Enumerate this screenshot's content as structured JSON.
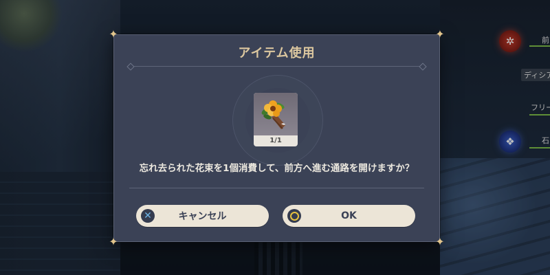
{
  "dialog": {
    "title": "アイテム使用",
    "item": {
      "icon": "flower-bouquet-icon",
      "count": "1/1"
    },
    "message": "忘れ去られた花束を1個消費して、前方へ進む通路を開けますか？",
    "buttons": {
      "cancel": {
        "label": "キャンセル",
        "icon": "cross-button-icon"
      },
      "ok": {
        "label": "OK",
        "icon": "circle-button-icon"
      }
    }
  },
  "hud": {
    "party_names": [
      "ディシア",
      "フリー"
    ],
    "element_icons": [
      "pyro-element-icon",
      "geo-element-icon"
    ]
  },
  "colors": {
    "panel": "#3b4256",
    "title": "#dcc79f",
    "button": "#ece5d7",
    "accent_corner": "#e2c58c"
  }
}
